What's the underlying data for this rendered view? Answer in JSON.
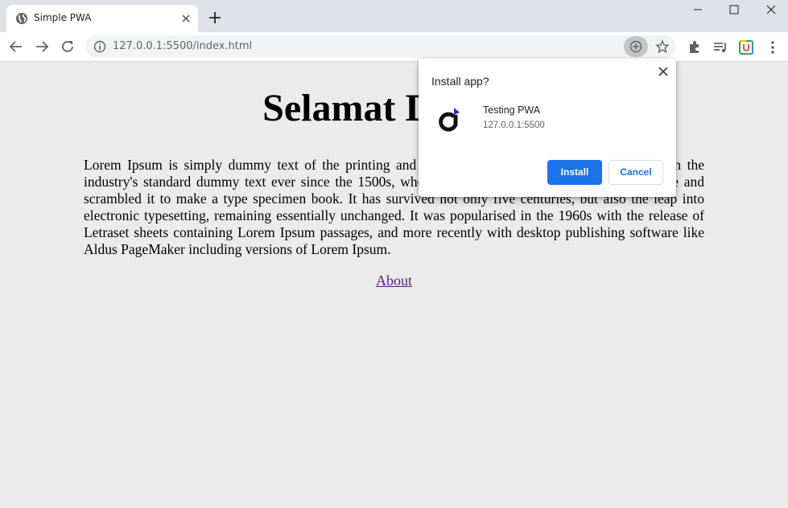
{
  "browser": {
    "tab": {
      "title": "Simple PWA",
      "favicon": "globe-icon"
    },
    "window_controls": [
      "minimize-icon",
      "maximize-icon",
      "close-icon"
    ],
    "address_bar": {
      "url": "127.0.0.1:5500/index.html"
    }
  },
  "page": {
    "heading": "Selamat Datang",
    "paragraph": "Lorem Ipsum is simply dummy text of the printing and typesetting industry. Lorem Ipsum has been the industry's standard dummy text ever since the 1500s, when an unknown printer took a galley of type and scrambled it to make a type specimen book. It has survived not only five centuries, but also the leap into electronic typesetting, remaining essentially unchanged. It was popularised in the 1960s with the release of Letraset sheets containing Lorem Ipsum passages, and more recently with desktop publishing software like Aldus PageMaker including versions of Lorem Ipsum.",
    "link": "About"
  },
  "install_dialog": {
    "title": "Install app?",
    "app_name": "Testing PWA",
    "app_origin": "127.0.0.1:5500",
    "install_label": "Install",
    "cancel_label": "Cancel"
  },
  "colors": {
    "accent": "#1a73e8",
    "page_bg": "#ebebeb",
    "tabstrip_bg": "#dee1e6",
    "link": "#551a8b"
  }
}
